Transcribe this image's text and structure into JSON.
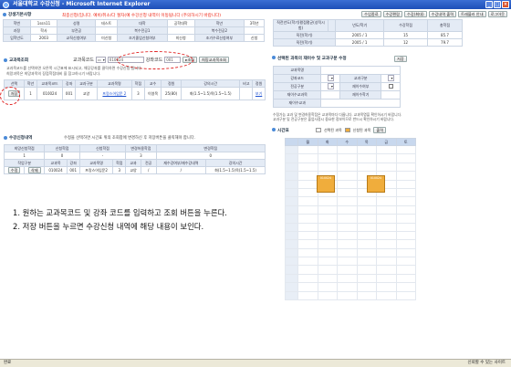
{
  "window": {
    "title": "서울대학교 수강신청 - Microsoft Internet Explorer",
    "minimize": "_",
    "maximize": "□",
    "close": "×"
  },
  "notice": "최종신청(입니다. 예비/취소/다 절차(예 수강신청 내역이 이동됩니다 (주의하시기 바랍니다)",
  "top_buttons": [
    "수업종료",
    "수강편람",
    "수강(최대)",
    "수강내역 출력",
    "트래블러 안내",
    "로그아웃"
  ],
  "student": {
    "section_title": "강생기본사항",
    "rows": [
      [
        "학번",
        "1ssn11",
        "성명",
        "테스트",
        "대학",
        "공학대학",
        "학년",
        "3학년"
      ],
      [
        "과정",
        "학사",
        "부전공",
        "",
        "복수전공1",
        "",
        "복수전공2",
        ""
      ],
      [
        "입학년도",
        "2003",
        "교직신청여부",
        "미신청",
        "조기졸업신청여부",
        "미신청",
        "조기수료신청여부",
        "신청"
      ]
    ]
  },
  "credit": {
    "headers": [
      "직전년도(학기)평점평균(성적시험)",
      "",
      "년도/학기",
      "수강학점",
      "총학점"
    ],
    "rows": [
      [
        "직전(학기)",
        "2005 / 1",
        "15",
        "85.7"
      ],
      [
        "직전(학기)",
        "2005 / 1",
        "12",
        "79.7"
      ]
    ]
  },
  "search": {
    "section_title": "교과목조회",
    "course_label": "교과목코드",
    "course_value": "010024",
    "section_label": "강좌코드",
    "section_value": "001",
    "search_button": "조회",
    "full_search_button": "희망교과목조회",
    "guide_lines": [
      "교과목코드를 선택하면 오른쪽 시간표에 표시되고, 해당강좌를 클릭하면 수강신청 됩니다.",
      "희망과목은 희망과목의 장점학점대비 을 참고하시기 바랍니다."
    ],
    "guide_link": "희망과목의 장점학점대비"
  },
  "courses": {
    "headers": [
      "선택",
      "학년",
      "교과목코드",
      "강좌",
      "교과구분",
      "교과목명",
      "학점",
      "교수",
      "정원",
      "강의시간",
      "비고",
      "정원"
    ],
    "row": {
      "select": "저장",
      "year": "1",
      "code": "010024",
      "section": "001",
      "type": "교양",
      "name": "프랑스어입문 2",
      "credit": "3",
      "prof": "이영목",
      "cap": "25(80)",
      "time": "화(1.5~1.5)목(1.5~1.5)",
      "note": "",
      "quota": "보기"
    }
  },
  "enrolled": {
    "section_title": "수강신청내역",
    "hint": "수정을 선택하면 시간표 위의 조회창에 변경하신 후 저장버튼을 클릭해야 합니다.",
    "group_headers": [
      "희망신청학점",
      "신청학점",
      "신청학점",
      "변경허용학점",
      "변경학점"
    ],
    "group_values": [
      "1",
      "0",
      "-",
      "3",
      "0"
    ],
    "headers": [
      "작업구분",
      "교과목",
      "강좌",
      "교과목명",
      "학점",
      "교과",
      "전공",
      "재수강여부/재수강내역",
      "강의시간"
    ],
    "row": {
      "action": "수정",
      "delete": "삭제",
      "code": "010024",
      "section": "001",
      "name": "프랑스어입문2",
      "credit": "3",
      "type": "교양",
      "major": "/",
      "retake": "/",
      "time": "화(1.5~1.5)목(1.5~1.5)"
    }
  },
  "filter": {
    "title": "선택된 과목의 재이수 및 교과구분 수정",
    "save_button": "저장",
    "rows": [
      [
        "교과목명",
        "",
        "",
        ""
      ],
      [
        "강좌코드",
        "",
        "교과구분",
        ""
      ],
      [
        "전공구분",
        "",
        "재이수여부",
        ""
      ],
      [
        "재이수교과목",
        "",
        "재이수학기",
        ""
      ],
      [
        "재이수교과",
        "",
        "",
        ""
      ]
    ],
    "notes": [
      "수정가능 교과 및 변경허용학점은 교과목마다 다릅니다. 교과목명을 확인하시기 바랍니다.",
      "교과구분 및 전공구분은 졸업사정시 중요한 정보이므로 반드시 확인하시기 바랍니다."
    ]
  },
  "timetable": {
    "title": "시간표",
    "legend_selected": "선택된 과목",
    "legend_enrolled": "신청된 과목",
    "print_button": "출력",
    "days": [
      "",
      "월",
      "화",
      "수",
      "목",
      "금",
      "토"
    ],
    "blocks": [
      "010024",
      "010024"
    ]
  },
  "instructions": [
    "1. 원하는 교과목코드 및 강좌 코드를 입력하고 조회 버튼을 누른다.",
    "2. 저장 버튼을 누르면 수강신청 내역에 해당 내용이 보인다."
  ],
  "status": {
    "left": "완료",
    "right": "신뢰할 수 있는 사이트"
  },
  "colors": {
    "accent": "#4a8ad8",
    "header_bg": "#e4ebf5",
    "block": "#f0ad3c",
    "notice": "#e21111"
  }
}
